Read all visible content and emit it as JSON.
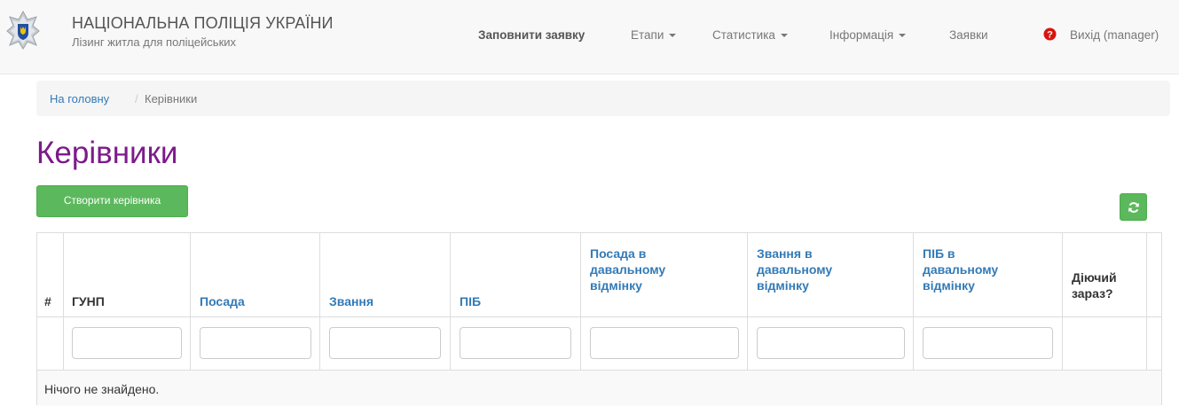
{
  "brand": {
    "title": "НАЦІОНАЛЬНА ПОЛІЦІЯ УКРАЇНИ",
    "subtitle": "Лізинг житла для поліцейських",
    "logo_icon": "police-star-emblem-icon"
  },
  "nav": {
    "fill_request": "Заповнити заявку",
    "stages": "Етапи",
    "statistics": "Статистика",
    "information": "Інформація",
    "requests": "Заявки",
    "help_icon": "question-circle-icon",
    "logout": "Вихід (manager)"
  },
  "breadcrumb": {
    "home": "На головну",
    "separator": "/",
    "current": "Керівники"
  },
  "page": {
    "title": "Керівники",
    "create_button": "Створити керівника",
    "refresh_icon": "refresh-icon"
  },
  "table": {
    "columns": {
      "num": "#",
      "gunp": "ГУНП",
      "position": "Посада",
      "rank": "Звання",
      "name": "ПІБ",
      "position_dative": [
        "Посада в",
        "давальному",
        "відмінку"
      ],
      "rank_dative": [
        "Звання в",
        "давальному",
        "відмінку"
      ],
      "name_dative": [
        "ПІБ в",
        "давальному",
        "відмінку"
      ],
      "active": [
        "Діючий",
        "зараз?"
      ]
    },
    "filters": {
      "gunp": "",
      "position": "",
      "rank": "",
      "name": "",
      "position_dative": "",
      "rank_dative": "",
      "name_dative": ""
    },
    "empty_message": "Нічого не знайдено."
  },
  "colors": {
    "title_purple": "#7d1a8b",
    "link_blue": "#337ab7",
    "success_green": "#5cb85c",
    "help_red": "#d9140d"
  }
}
